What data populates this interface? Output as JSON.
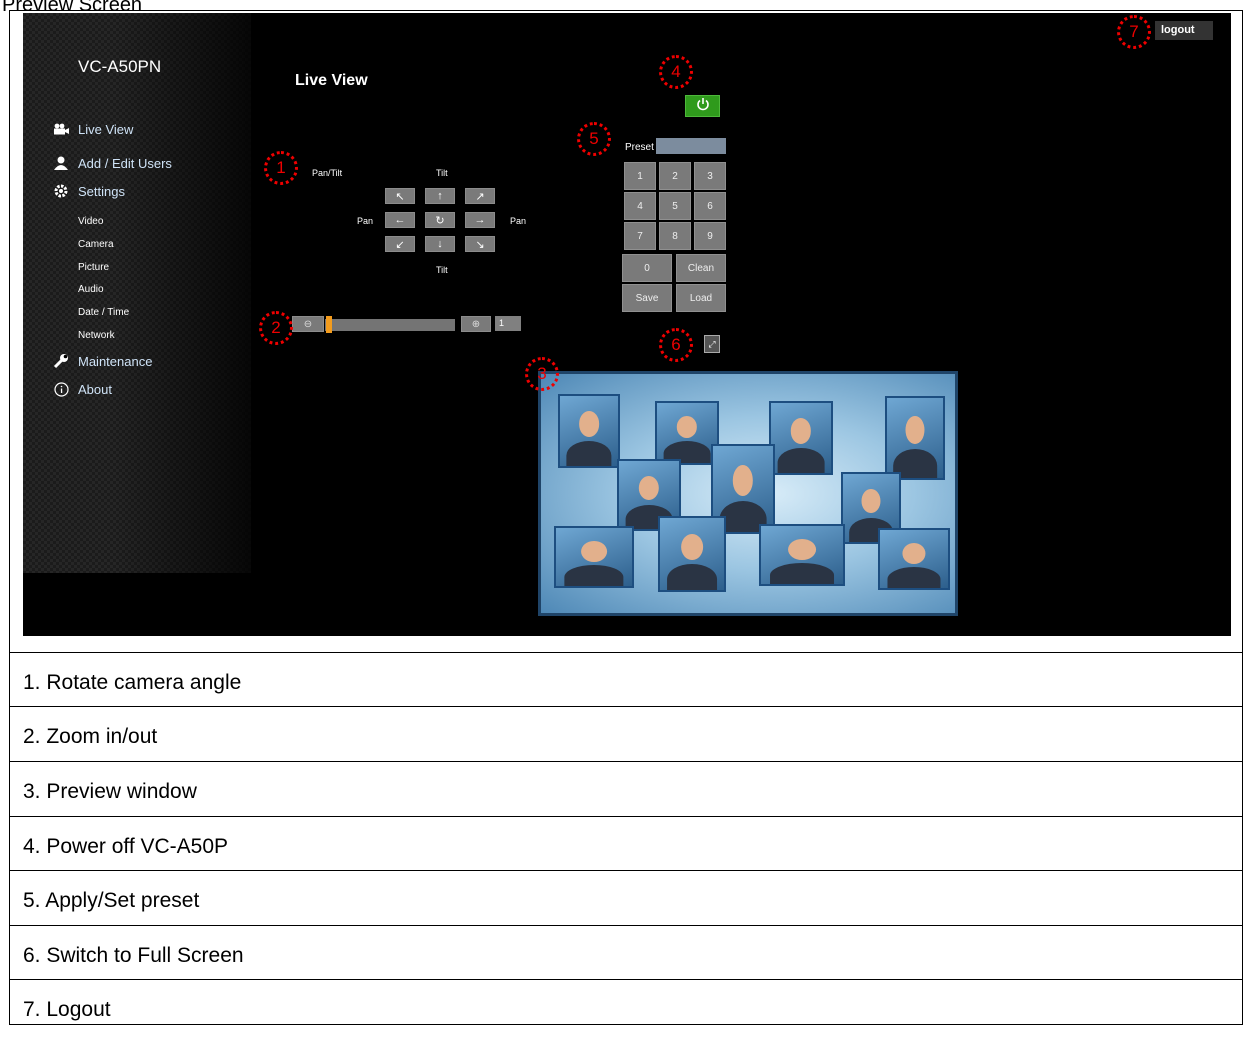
{
  "caption": "Preview Screen",
  "app": {
    "model": "VC-A50PN",
    "page_title": "Live View",
    "logout_label": "logout"
  },
  "sidebar": {
    "live_view": "Live View",
    "users": "Add / Edit Users",
    "settings": "Settings",
    "sub_items": [
      "Video",
      "Camera",
      "Picture",
      "Audio",
      "Date / Time",
      "Network"
    ],
    "maintenance": "Maintenance",
    "about": "About"
  },
  "ptz": {
    "pan_tilt_label": "Pan/Tilt",
    "tilt_label": "Tilt",
    "pan_label": "Pan",
    "buttons": {
      "up_left": "↖",
      "up": "↑",
      "up_right": "↗",
      "left": "←",
      "home": "↻",
      "right": "→",
      "down_left": "↙",
      "down": "↓",
      "down_right": "↘"
    }
  },
  "zoom": {
    "out_icon": "⊖",
    "in_icon": "⊕",
    "value": "1",
    "level": 0.0
  },
  "power": {
    "icon": "power-icon"
  },
  "preset": {
    "label": "Preset",
    "value": "",
    "keys": [
      "1",
      "2",
      "3",
      "4",
      "5",
      "6",
      "7",
      "8",
      "9"
    ],
    "zero": "0",
    "clean": "Clean",
    "save": "Save",
    "load": "Load"
  },
  "markers": [
    "1",
    "2",
    "3",
    "4",
    "5",
    "6",
    "7"
  ],
  "legend": [
    "1. Rotate camera angle",
    "2. Zoom in/out",
    "3. Preview window",
    "4. Power off VC-A50P",
    "5. Apply/Set preset",
    "6. Switch to Full Screen",
    "7. Logout"
  ],
  "colors": {
    "power": "#2f9a1c",
    "zoom_thumb": "#f39c1d",
    "marker": "#e00000",
    "nav_text": "#cfe3f7"
  }
}
